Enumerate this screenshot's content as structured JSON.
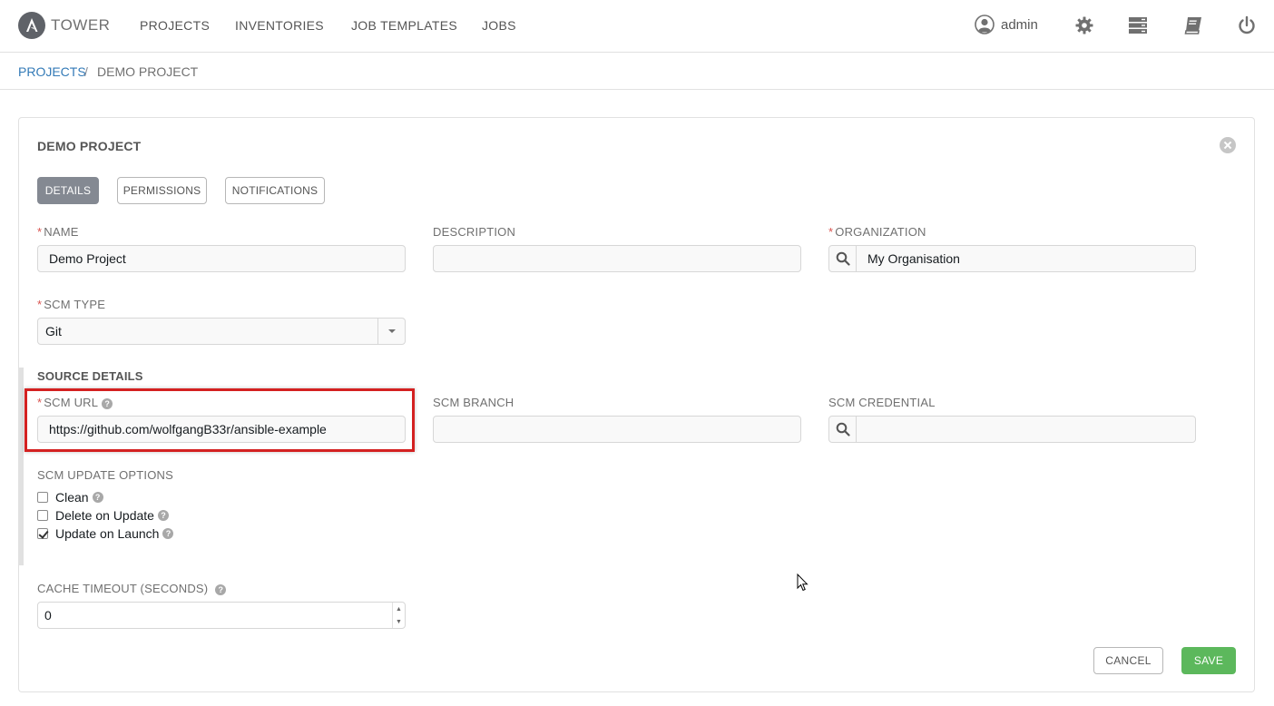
{
  "app": {
    "name": "TOWER"
  },
  "nav": {
    "items": [
      "PROJECTS",
      "INVENTORIES",
      "JOB TEMPLATES",
      "JOBS"
    ]
  },
  "user": {
    "name": "admin"
  },
  "header_icons": [
    "user-icon",
    "gear-icon",
    "server-icon",
    "book-icon",
    "power-icon"
  ],
  "breadcrumb": {
    "parent": "PROJECTS",
    "separator": "/",
    "current": "DEMO PROJECT"
  },
  "panel": {
    "title": "DEMO PROJECT",
    "tabs": [
      "DETAILS",
      "PERMISSIONS",
      "NOTIFICATIONS"
    ],
    "active_tab": "DETAILS"
  },
  "form": {
    "required_mark": "*",
    "name": {
      "label": "NAME",
      "value": "Demo Project"
    },
    "description": {
      "label": "DESCRIPTION",
      "value": ""
    },
    "organization": {
      "label": "ORGANIZATION",
      "value": "My Organisation"
    },
    "scm_type": {
      "label": "SCM TYPE",
      "value": "Git"
    },
    "source_details": {
      "title": "SOURCE DETAILS"
    },
    "scm_url": {
      "label": "SCM URL",
      "value": "https://github.com/wolfgangB33r/ansible-example"
    },
    "scm_branch": {
      "label": "SCM BRANCH",
      "value": ""
    },
    "scm_credential": {
      "label": "SCM CREDENTIAL",
      "value": ""
    },
    "update_options": {
      "label": "SCM UPDATE OPTIONS",
      "clean": {
        "label": "Clean",
        "checked": false
      },
      "delete_on_update": {
        "label": "Delete on Update",
        "checked": false
      },
      "update_on_launch": {
        "label": "Update on Launch",
        "checked": true
      }
    },
    "cache_timeout": {
      "label": "CACHE TIMEOUT (SECONDS)",
      "value": "0"
    }
  },
  "buttons": {
    "cancel": "CANCEL",
    "save": "SAVE"
  },
  "help_glyph": "?",
  "colors": {
    "save": "#5cb85c",
    "active_tab": "#848992",
    "link": "#337ab7",
    "required": "#d9534f",
    "highlight": "#d42121"
  }
}
